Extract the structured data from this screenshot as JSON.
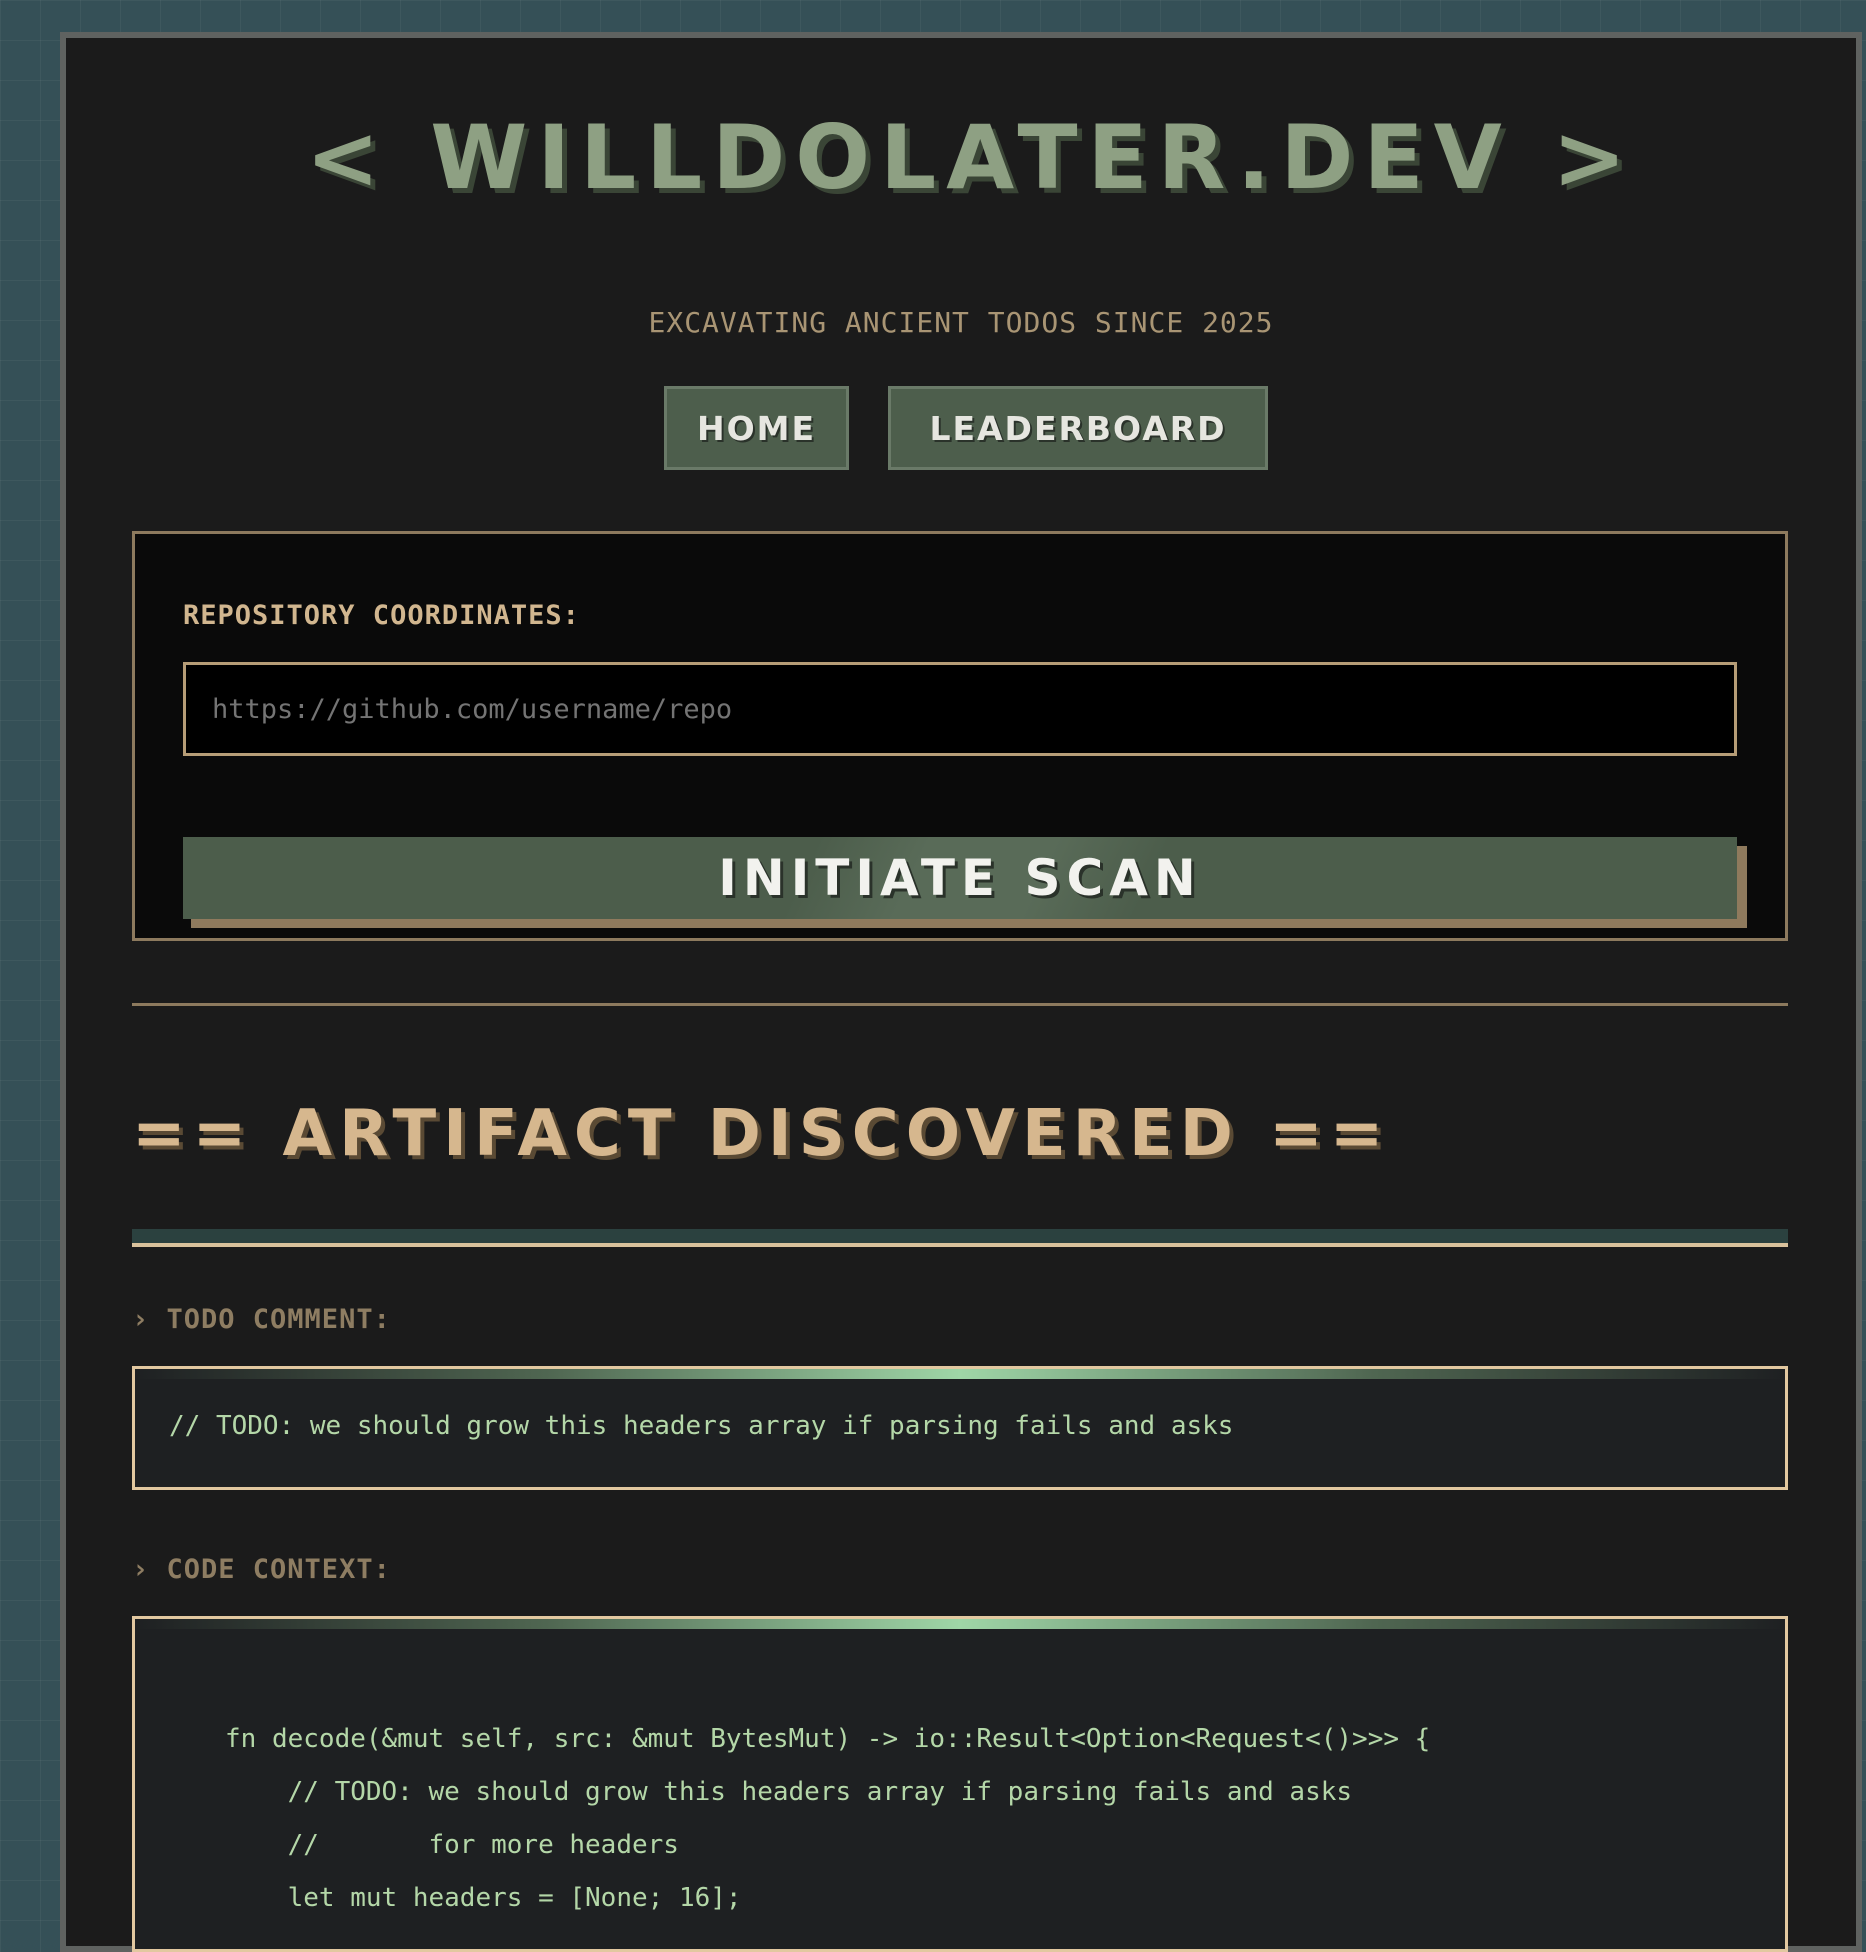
{
  "header": {
    "title": "< WILLDOLATER.DEV >",
    "tagline": "EXCAVATING ANCIENT TODOS SINCE 2025"
  },
  "nav": {
    "home_label": "HOME",
    "leaderboard_label": "LEADERBOARD"
  },
  "scan": {
    "label": "REPOSITORY COORDINATES:",
    "input_value": "",
    "input_placeholder": "https://github.com/username/repo",
    "button_label": "INITIATE SCAN"
  },
  "artifact": {
    "heading": "== ARTIFACT DISCOVERED ==",
    "todo_label": "› TODO COMMENT:",
    "todo_text": "// TODO: we should grow this headers array if parsing fails and asks",
    "code_label": "› CODE CONTEXT:",
    "code_lines": [
      "fn decode(&mut self, src: &mut BytesMut) -> io::Result<Option<Request<()>>> {",
      "    // TODO: we should grow this headers array if parsing fails and asks",
      "    //       for more headers",
      "    let mut headers = [None; 16];"
    ]
  },
  "colors": {
    "background": "#355057",
    "panel": "#1b1b1b",
    "title_green": "#8ea083",
    "accent_tan": "#d6b78e",
    "button_green": "#4d5e4c",
    "code_green": "#b4d7a8"
  }
}
